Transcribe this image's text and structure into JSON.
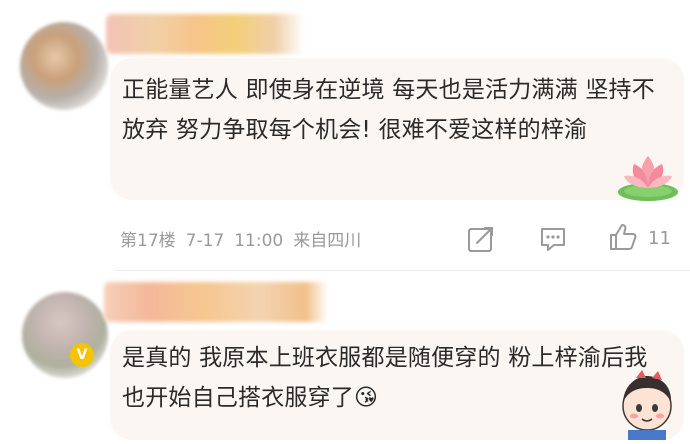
{
  "comments": [
    {
      "text": "正能量艺人 即使身在逆境 每天也是活力满满 坚持不放弃 努力争取每个机会! 很难不爱这样的梓渝",
      "floor": "第17楼",
      "date": "7-17",
      "time": "11:00",
      "location": "来自四川",
      "like_count": "11",
      "sticker": "lotus"
    },
    {
      "text": "是真的 我原本上班衣服都是随便穿的 粉上梓渝后我也开始自己搭衣服穿了",
      "emoji": "😘",
      "badge": "V",
      "sticker": "cartoon-character"
    }
  ],
  "icons": {
    "edit": "edit-icon",
    "reply": "reply-icon",
    "like": "thumbs-up-icon"
  },
  "colors": {
    "bubble": "#fbf6f2",
    "text": "#2a2a2a",
    "meta": "#9a9a9a",
    "badge": "#f5c400"
  }
}
